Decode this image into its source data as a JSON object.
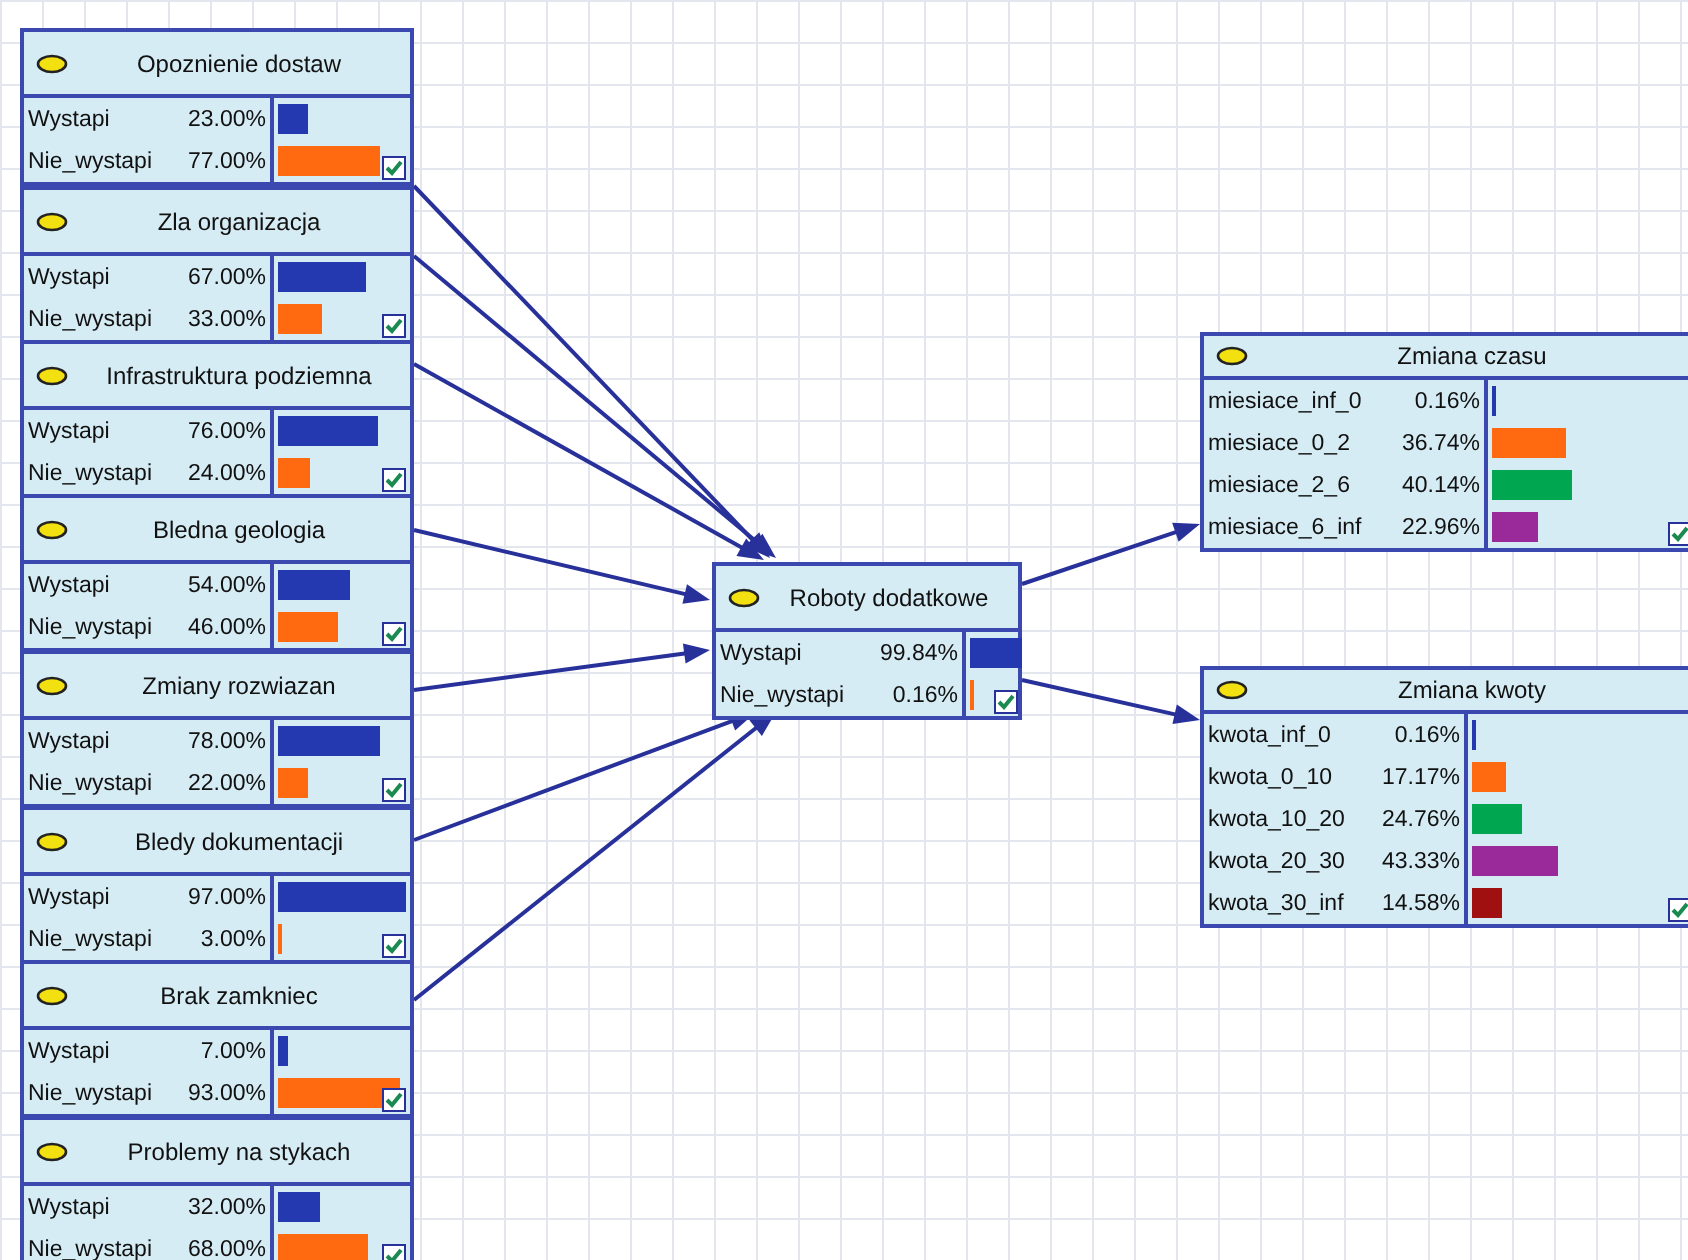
{
  "causes": [
    {
      "title": "Opoznienie dostaw",
      "linked": true,
      "checked": true,
      "states": [
        {
          "label": "Wystapi",
          "value": "23.00%",
          "color": "#2438b0"
        },
        {
          "label": "Nie_wystapi",
          "value": "77.00%",
          "color": "#ff6a10"
        }
      ]
    },
    {
      "title": "Zla organizacja",
      "linked": true,
      "checked": true,
      "states": [
        {
          "label": "Wystapi",
          "value": "67.00%",
          "color": "#2438b0"
        },
        {
          "label": "Nie_wystapi",
          "value": "33.00%",
          "color": "#ff6a10"
        }
      ]
    },
    {
      "title": "Infrastruktura podziemna",
      "linked": true,
      "checked": true,
      "states": [
        {
          "label": "Wystapi",
          "value": "76.00%",
          "color": "#2438b0"
        },
        {
          "label": "Nie_wystapi",
          "value": "24.00%",
          "color": "#ff6a10"
        }
      ]
    },
    {
      "title": "Bledna geologia",
      "linked": true,
      "checked": true,
      "states": [
        {
          "label": "Wystapi",
          "value": "54.00%",
          "color": "#2438b0"
        },
        {
          "label": "Nie_wystapi",
          "value": "46.00%",
          "color": "#ff6a10"
        }
      ]
    },
    {
      "title": "Zmiany rozwiazan",
      "linked": true,
      "checked": true,
      "states": [
        {
          "label": "Wystapi",
          "value": "78.00%",
          "color": "#2438b0"
        },
        {
          "label": "Nie_wystapi",
          "value": "22.00%",
          "color": "#ff6a10"
        }
      ]
    },
    {
      "title": "Bledy dokumentacji",
      "linked": true,
      "checked": true,
      "states": [
        {
          "label": "Wystapi",
          "value": "97.00%",
          "color": "#2438b0"
        },
        {
          "label": "Nie_wystapi",
          "value": "3.00%",
          "color": "#ff6a10"
        }
      ]
    },
    {
      "title": "Brak zamkniec",
      "linked": true,
      "checked": true,
      "states": [
        {
          "label": "Wystapi",
          "value": "7.00%",
          "color": "#2438b0"
        },
        {
          "label": "Nie_wystapi",
          "value": "93.00%",
          "color": "#ff6a10"
        }
      ]
    },
    {
      "title": "Problemy na stykach",
      "linked": false,
      "checked": true,
      "states": [
        {
          "label": "Wystapi",
          "value": "32.00%",
          "color": "#2438b0"
        },
        {
          "label": "Nie_wystapi",
          "value": "68.00%",
          "color": "#ff6a10"
        }
      ]
    }
  ],
  "central": {
    "title": "Roboty dodatkowe",
    "checked": true,
    "states": [
      {
        "label": "Wystapi",
        "value": "99.84%",
        "color": "#2438b0"
      },
      {
        "label": "Nie_wystapi",
        "value": "0.16%",
        "color": "#ff6a10"
      }
    ]
  },
  "effects": [
    {
      "title": "Zmiana czasu",
      "checked": true,
      "states": [
        {
          "label": "miesiace_inf_0",
          "value": "0.16%",
          "color": "#2438b0"
        },
        {
          "label": "miesiace_0_2",
          "value": "36.74%",
          "color": "#ff6a10"
        },
        {
          "label": "miesiace_2_6",
          "value": "40.14%",
          "color": "#00a650"
        },
        {
          "label": "miesiace_6_inf",
          "value": "22.96%",
          "color": "#9a2a9a"
        }
      ]
    },
    {
      "title": "Zmiana kwoty",
      "checked": true,
      "states": [
        {
          "label": "kwota_inf_0",
          "value": "0.16%",
          "color": "#2438b0"
        },
        {
          "label": "kwota_0_10",
          "value": "17.17%",
          "color": "#ff6a10"
        },
        {
          "label": "kwota_10_20",
          "value": "24.76%",
          "color": "#00a650"
        },
        {
          "label": "kwota_20_30",
          "value": "43.33%",
          "color": "#9a2a9a"
        },
        {
          "label": "kwota_30_inf",
          "value": "14.58%",
          "color": "#a01010"
        }
      ]
    }
  ]
}
